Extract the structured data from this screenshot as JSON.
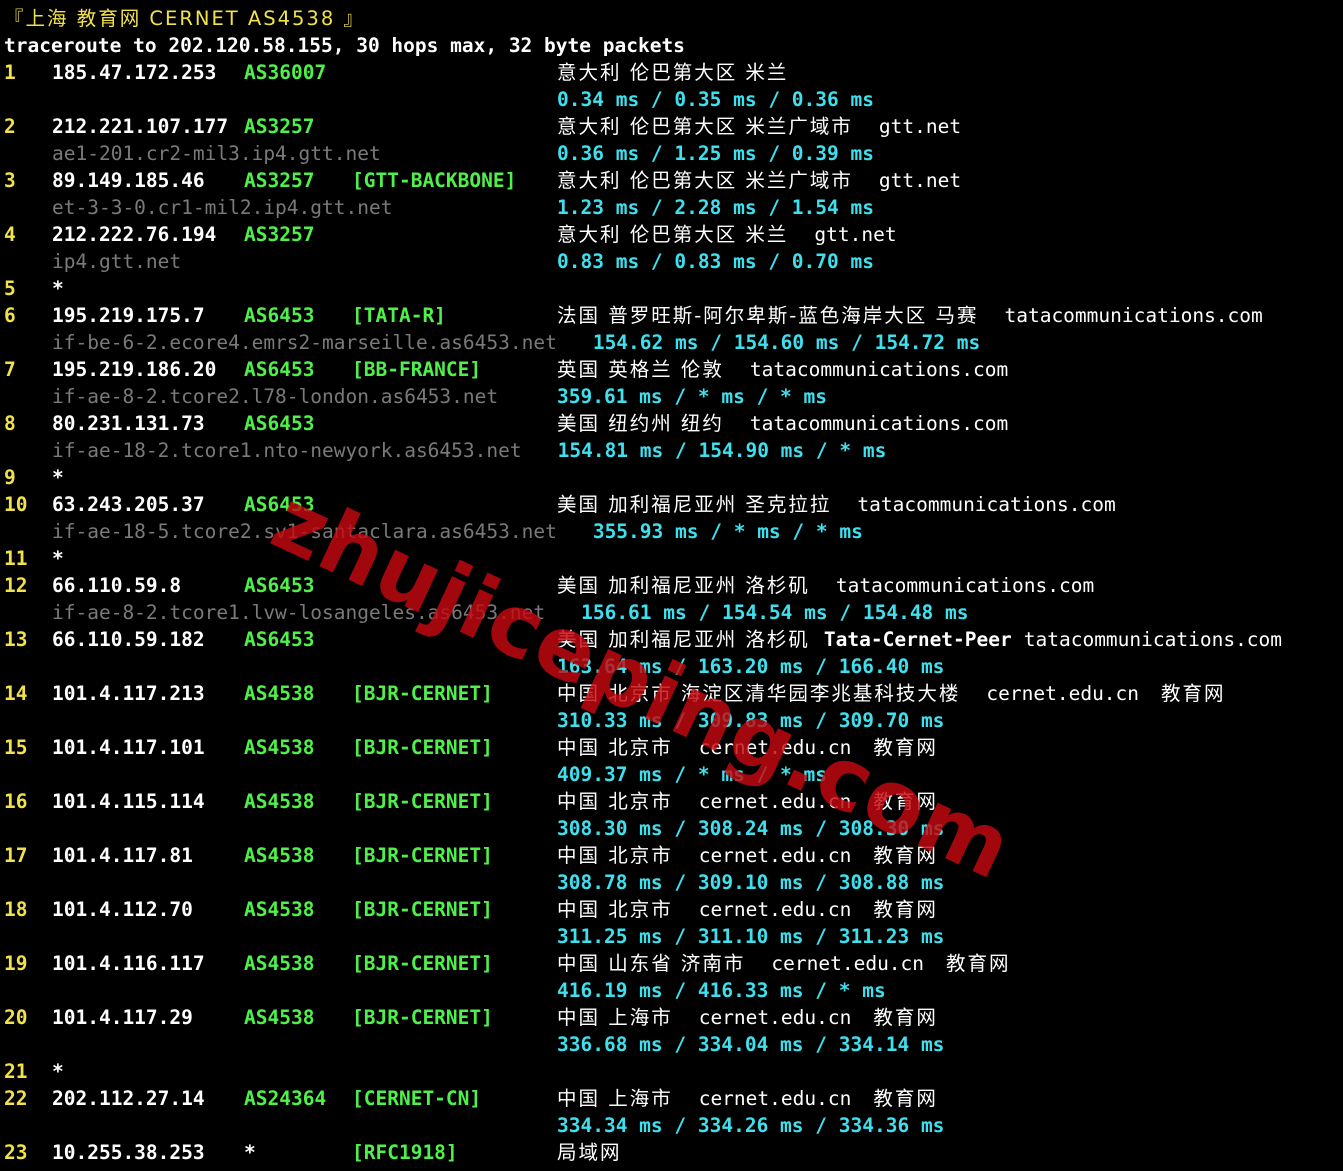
{
  "header": {
    "title": "『上海 教育网 CERNET AS4538 』",
    "command": "traceroute to 202.120.58.155, 30 hops max, 32 byte packets"
  },
  "watermark": "zhujiceping.com",
  "hops": [
    {
      "num": "1",
      "ip": "185.47.172.253",
      "as": "AS36007",
      "tag": "",
      "geo": "意大利 伦巴第大区 米兰",
      "org": "",
      "host": "",
      "rtt": "0.34 ms / 0.35 ms / 0.36 ms"
    },
    {
      "num": "2",
      "ip": "212.221.107.177",
      "as": "AS3257",
      "tag": "",
      "geo": "意大利 伦巴第大区 米兰广域市",
      "org": "gtt.net",
      "host": "ae1-201.cr2-mil3.ip4.gtt.net",
      "rtt": "0.36 ms / 1.25 ms / 0.39 ms"
    },
    {
      "num": "3",
      "ip": "89.149.185.46",
      "as": "AS3257",
      "tag": "[GTT-BACKBONE]",
      "geo": "意大利 伦巴第大区 米兰广域市",
      "org": "gtt.net",
      "host": "et-3-3-0.cr1-mil2.ip4.gtt.net",
      "rtt": "1.23 ms / 2.28 ms / 1.54 ms"
    },
    {
      "num": "4",
      "ip": "212.222.76.194",
      "as": "AS3257",
      "tag": "",
      "geo": "意大利 伦巴第大区 米兰",
      "org": "gtt.net",
      "host": "ip4.gtt.net",
      "rtt": "0.83 ms / 0.83 ms / 0.70 ms"
    },
    {
      "num": "5",
      "star": "*"
    },
    {
      "num": "6",
      "ip": "195.219.175.7",
      "as": "AS6453",
      "tag": "[TATA-R]",
      "geo": "法国 普罗旺斯-阿尔卑斯-蓝色海岸大区 马赛",
      "org": "tatacommunications.com",
      "host": "if-be-6-2.ecore4.emrs2-marseille.as6453.net",
      "rtt": "154.62 ms / 154.60 ms / 154.72 ms"
    },
    {
      "num": "7",
      "ip": "195.219.186.20",
      "as": "AS6453",
      "tag": "[BB-FRANCE]",
      "geo": "英国 英格兰 伦敦",
      "org": "tatacommunications.com",
      "host": "if-ae-8-2.tcore2.l78-london.as6453.net",
      "rtt": "359.61 ms / * ms / * ms"
    },
    {
      "num": "8",
      "ip": "80.231.131.73",
      "as": "AS6453",
      "tag": "",
      "geo": "美国 纽约州 纽约",
      "org": "tatacommunications.com",
      "host": "if-ae-18-2.tcore1.nto-newyork.as6453.net",
      "rtt": "154.81 ms / 154.90 ms / * ms"
    },
    {
      "num": "9",
      "star": "*"
    },
    {
      "num": "10",
      "ip": "63.243.205.37",
      "as": "AS6453",
      "tag": "",
      "geo": "美国 加利福尼亚州 圣克拉拉",
      "org": "tatacommunications.com",
      "host": "if-ae-18-5.tcore2.sv1-santaclara.as6453.net",
      "rtt": "355.93 ms / * ms / * ms"
    },
    {
      "num": "11",
      "star": "*"
    },
    {
      "num": "12",
      "ip": "66.110.59.8",
      "as": "AS6453",
      "tag": "",
      "geo": "美国 加利福尼亚州 洛杉矶",
      "org": "tatacommunications.com",
      "host": "if-ae-8-2.tcore1.lvw-losangeles.as6453.net",
      "rtt": "156.61 ms / 154.54 ms / 154.48 ms"
    },
    {
      "num": "13",
      "ip": "66.110.59.182",
      "as": "AS6453",
      "tag": "",
      "geo": "美国 加利福尼亚州 洛杉矶",
      "peer": "Tata-Cernet-Peer",
      "org": "tatacommunications.com",
      "host": "",
      "rtt": "163.64 ms / 163.20 ms / 166.40 ms"
    },
    {
      "num": "14",
      "ip": "101.4.117.213",
      "as": "AS4538",
      "tag": "[BJR-CERNET]",
      "geo": "中国 北京市 海淀区清华园李兆基科技大楼",
      "org": "cernet.edu.cn",
      "net": "教育网",
      "host": "",
      "rtt": "310.33 ms / 309.83 ms / 309.70 ms"
    },
    {
      "num": "15",
      "ip": "101.4.117.101",
      "as": "AS4538",
      "tag": "[BJR-CERNET]",
      "geo": "中国 北京市",
      "org": "cernet.edu.cn",
      "net": "教育网",
      "host": "",
      "rtt": "409.37 ms / * ms / * ms"
    },
    {
      "num": "16",
      "ip": "101.4.115.114",
      "as": "AS4538",
      "tag": "[BJR-CERNET]",
      "geo": "中国 北京市",
      "org": "cernet.edu.cn",
      "net": "教育网",
      "host": "",
      "rtt": "308.30 ms / 308.24 ms / 308.30 ms"
    },
    {
      "num": "17",
      "ip": "101.4.117.81",
      "as": "AS4538",
      "tag": "[BJR-CERNET]",
      "geo": "中国 北京市",
      "org": "cernet.edu.cn",
      "net": "教育网",
      "host": "",
      "rtt": "308.78 ms / 309.10 ms / 308.88 ms"
    },
    {
      "num": "18",
      "ip": "101.4.112.70",
      "as": "AS4538",
      "tag": "[BJR-CERNET]",
      "geo": "中国 北京市",
      "org": "cernet.edu.cn",
      "net": "教育网",
      "host": "",
      "rtt": "311.25 ms / 311.10 ms / 311.23 ms"
    },
    {
      "num": "19",
      "ip": "101.4.116.117",
      "as": "AS4538",
      "tag": "[BJR-CERNET]",
      "geo": "中国 山东省 济南市",
      "org": "cernet.edu.cn",
      "net": "教育网",
      "host": "",
      "rtt": "416.19 ms / 416.33 ms / * ms"
    },
    {
      "num": "20",
      "ip": "101.4.117.29",
      "as": "AS4538",
      "tag": "[BJR-CERNET]",
      "geo": "中国 上海市",
      "org": "cernet.edu.cn",
      "net": "教育网",
      "host": "",
      "rtt": "336.68 ms / 334.04 ms / 334.14 ms"
    },
    {
      "num": "21",
      "star": "*"
    },
    {
      "num": "22",
      "ip": "202.112.27.14",
      "as": "AS24364",
      "tag": "[CERNET-CN]",
      "geo": "中国 上海市",
      "org": "cernet.edu.cn",
      "net": "教育网",
      "host": "",
      "rtt": "334.34 ms / 334.26 ms / 334.36 ms"
    },
    {
      "num": "23",
      "ip": "10.255.38.253",
      "as": "*",
      "tag": "[RFC1918]",
      "geo": "局域网",
      "org": "",
      "host": "",
      "rtt": ""
    }
  ]
}
